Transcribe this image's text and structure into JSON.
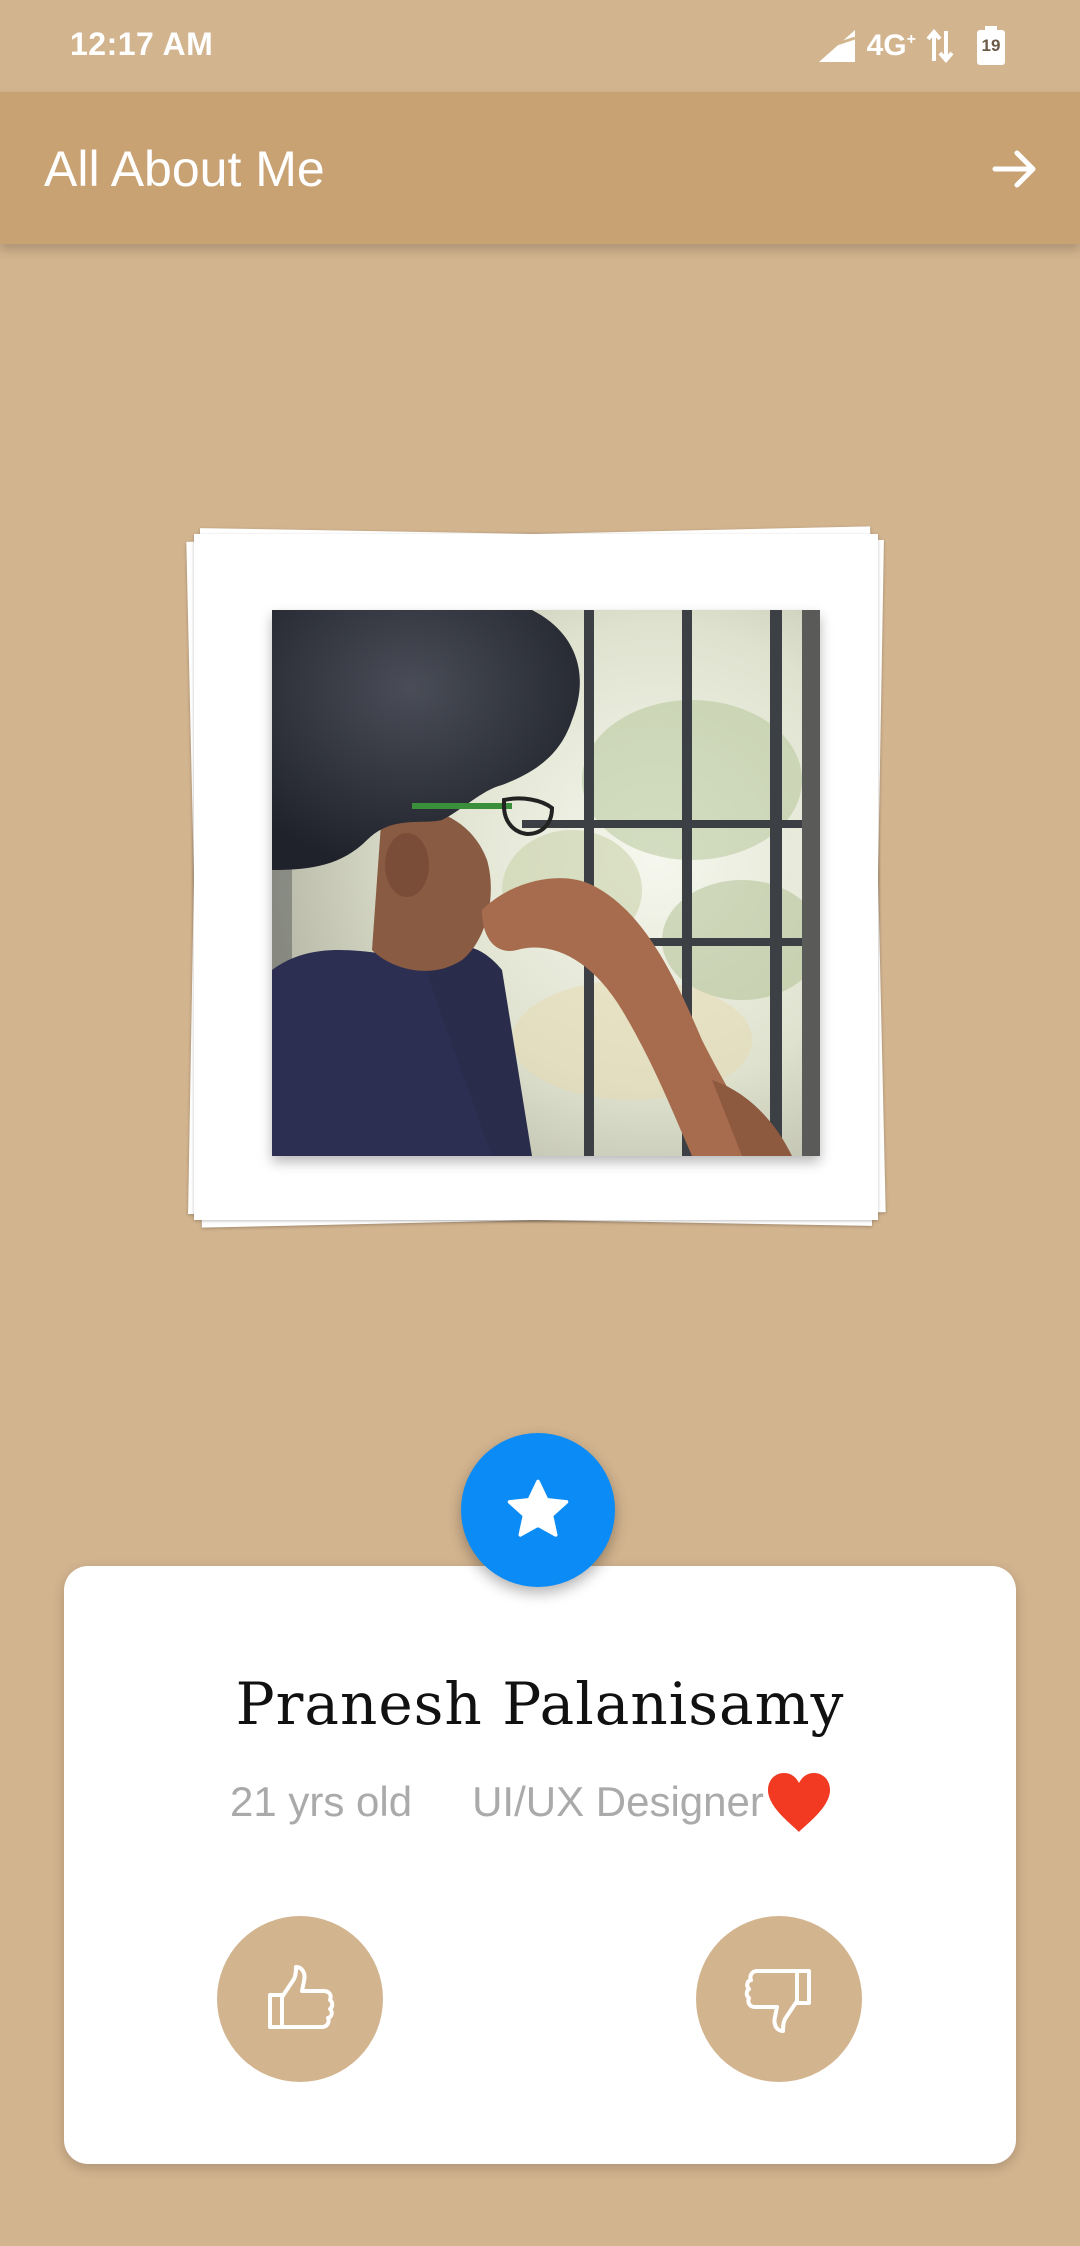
{
  "status_bar": {
    "time": "12:17 AM",
    "network": "4G",
    "network_sup": "+",
    "battery_level": "19"
  },
  "app_bar": {
    "title": "All About Me",
    "forward_icon": "arrow-forward-icon"
  },
  "fab": {
    "icon": "star-icon",
    "color": "#0A8BF5"
  },
  "profile": {
    "name": "Pranesh Palanisamy",
    "age": "21 yrs old",
    "role": "UI/UX Designer",
    "heart_icon": "heart-icon"
  },
  "actions": {
    "like_icon": "thumbs-up-icon",
    "dislike_icon": "thumbs-down-icon"
  },
  "colors": {
    "background": "#D2B48F",
    "app_bar": "#C9A274",
    "fab": "#0A8BF5",
    "heart": "#F23A22"
  }
}
